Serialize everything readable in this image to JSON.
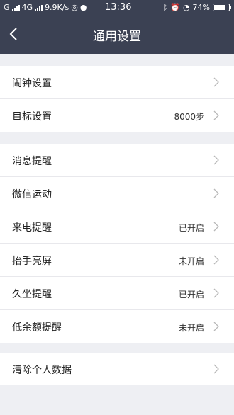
{
  "status": {
    "network_left": "G",
    "network_mid": "4G",
    "speed": "9.9K/s",
    "time": "13:36",
    "battery_pct": "74%",
    "battery_level": 0.74
  },
  "header": {
    "title": "通用设置"
  },
  "groups": [
    {
      "items": [
        {
          "label": "闹钟设置",
          "value": ""
        },
        {
          "label": "目标设置",
          "value": "8000步"
        }
      ]
    },
    {
      "items": [
        {
          "label": "消息提醒",
          "value": ""
        },
        {
          "label": "微信运动",
          "value": ""
        },
        {
          "label": "来电提醒",
          "value": "已开启"
        },
        {
          "label": "抬手亮屏",
          "value": "未开启"
        },
        {
          "label": "久坐提醒",
          "value": "已开启"
        },
        {
          "label": "低余额提醒",
          "value": "未开启"
        }
      ]
    },
    {
      "items": [
        {
          "label": "清除个人数据",
          "value": ""
        }
      ]
    }
  ],
  "colors": {
    "header_bg": "#3b4153",
    "page_bg": "#eeeff3",
    "chevron": "#b8b8b8"
  }
}
